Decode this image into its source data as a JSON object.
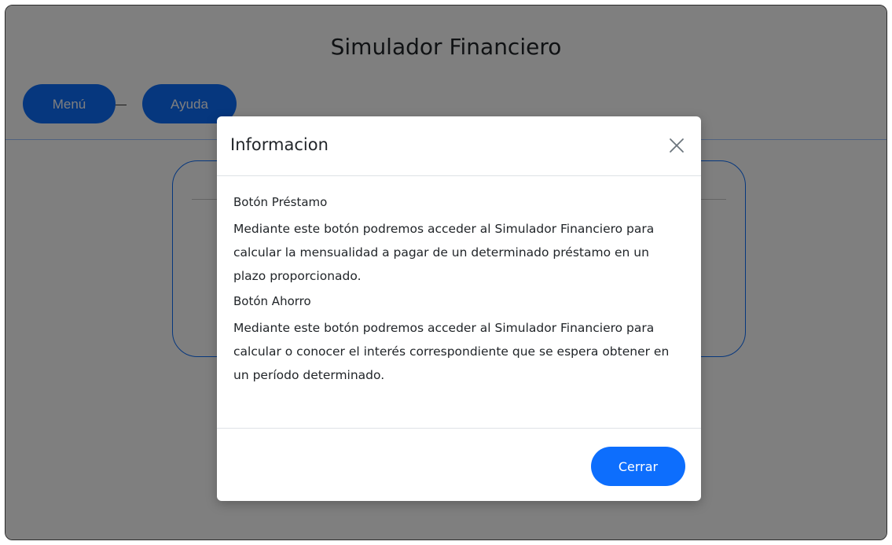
{
  "app": {
    "title": "Simulador Financiero",
    "nav": {
      "menu_label": "Menú",
      "help_label": "Ayuda"
    }
  },
  "modal": {
    "title": "Informacion",
    "close_icon": "close-icon",
    "sections": [
      {
        "title": "Botón Préstamo",
        "text": "Mediante este botón podremos acceder al Simulador Financiero para calcular la mensualidad a pagar de un determinado préstamo en un plazo proporcionado."
      },
      {
        "title": "Botón Ahorro",
        "text": "Mediante este botón podremos acceder al Simulador Financiero para calcular o conocer el interés correspondiente que se espera obtener en un período determinado."
      }
    ],
    "close_button_label": "Cerrar"
  },
  "colors": {
    "primary": "#0d6efd",
    "backdrop": "rgba(0,0,0,0.5)"
  }
}
